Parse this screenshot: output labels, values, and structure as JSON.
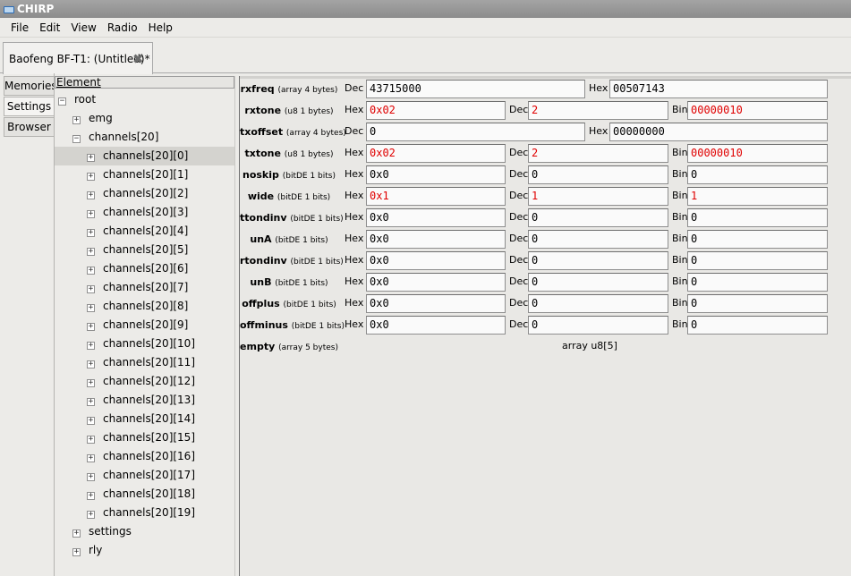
{
  "window": {
    "title": "CHIRP"
  },
  "menu": [
    "File",
    "Edit",
    "View",
    "Radio",
    "Help"
  ],
  "doc_tab": {
    "label": "Baofeng BF-T1: (Untitled)*"
  },
  "side_tabs": [
    "Memories",
    "Settings",
    "Browser"
  ],
  "tree": {
    "header": "Element",
    "nodes": [
      {
        "label": "root",
        "level": 0,
        "exp": "−"
      },
      {
        "label": "emg",
        "level": 1,
        "exp": "+"
      },
      {
        "label": "channels[20]",
        "level": 1,
        "exp": "−"
      },
      {
        "label": "channels[20][0]",
        "level": 2,
        "exp": "+",
        "selected": true
      },
      {
        "label": "channels[20][1]",
        "level": 2,
        "exp": "+"
      },
      {
        "label": "channels[20][2]",
        "level": 2,
        "exp": "+"
      },
      {
        "label": "channels[20][3]",
        "level": 2,
        "exp": "+"
      },
      {
        "label": "channels[20][4]",
        "level": 2,
        "exp": "+"
      },
      {
        "label": "channels[20][5]",
        "level": 2,
        "exp": "+"
      },
      {
        "label": "channels[20][6]",
        "level": 2,
        "exp": "+"
      },
      {
        "label": "channels[20][7]",
        "level": 2,
        "exp": "+"
      },
      {
        "label": "channels[20][8]",
        "level": 2,
        "exp": "+"
      },
      {
        "label": "channels[20][9]",
        "level": 2,
        "exp": "+"
      },
      {
        "label": "channels[20][10]",
        "level": 2,
        "exp": "+"
      },
      {
        "label": "channels[20][11]",
        "level": 2,
        "exp": "+"
      },
      {
        "label": "channels[20][12]",
        "level": 2,
        "exp": "+"
      },
      {
        "label": "channels[20][13]",
        "level": 2,
        "exp": "+"
      },
      {
        "label": "channels[20][14]",
        "level": 2,
        "exp": "+"
      },
      {
        "label": "channels[20][15]",
        "level": 2,
        "exp": "+"
      },
      {
        "label": "channels[20][16]",
        "level": 2,
        "exp": "+"
      },
      {
        "label": "channels[20][17]",
        "level": 2,
        "exp": "+"
      },
      {
        "label": "channels[20][18]",
        "level": 2,
        "exp": "+"
      },
      {
        "label": "channels[20][19]",
        "level": 2,
        "exp": "+"
      },
      {
        "label": "settings",
        "level": 1,
        "exp": "+"
      },
      {
        "label": "rly",
        "level": 1,
        "exp": "+"
      }
    ]
  },
  "fields": {
    "rxfreq": {
      "name": "rxfreq",
      "type": "(array 4 bytes)",
      "l1": "Dec",
      "v1": "43715000",
      "l2": "Hex",
      "v2": "00507143"
    },
    "rxtone": {
      "name": "rxtone",
      "type": "(u8 1 bytes)",
      "l1": "Hex",
      "v1": "0x02",
      "l2": "Dec",
      "v2": "2",
      "l3": "Bin",
      "v3": "00000010"
    },
    "txoffset": {
      "name": "txoffset",
      "type": "(array 4 bytes)",
      "l1": "Dec",
      "v1": "0",
      "l2": "Hex",
      "v2": "00000000"
    },
    "txtone": {
      "name": "txtone",
      "type": "(u8 1 bytes)",
      "l1": "Hex",
      "v1": "0x02",
      "l2": "Dec",
      "v2": "2",
      "l3": "Bin",
      "v3": "00000010"
    },
    "noskip": {
      "name": "noskip",
      "type": "(bitDE 1 bits)",
      "l1": "Hex",
      "v1": "0x0",
      "l2": "Dec",
      "v2": "0",
      "l3": "Bin",
      "v3": "0"
    },
    "wide": {
      "name": "wide",
      "type": "(bitDE 1 bits)",
      "l1": "Hex",
      "v1": "0x1",
      "l2": "Dec",
      "v2": "1",
      "l3": "Bin",
      "v3": "1"
    },
    "ttondinv": {
      "name": "ttondinv",
      "type": "(bitDE 1 bits)",
      "l1": "Hex",
      "v1": "0x0",
      "l2": "Dec",
      "v2": "0",
      "l3": "Bin",
      "v3": "0"
    },
    "unA": {
      "name": "unA",
      "type": "(bitDE 1 bits)",
      "l1": "Hex",
      "v1": "0x0",
      "l2": "Dec",
      "v2": "0",
      "l3": "Bin",
      "v3": "0"
    },
    "rtondinv": {
      "name": "rtondinv",
      "type": "(bitDE 1 bits)",
      "l1": "Hex",
      "v1": "0x0",
      "l2": "Dec",
      "v2": "0",
      "l3": "Bin",
      "v3": "0"
    },
    "unB": {
      "name": "unB",
      "type": "(bitDE 1 bits)",
      "l1": "Hex",
      "v1": "0x0",
      "l2": "Dec",
      "v2": "0",
      "l3": "Bin",
      "v3": "0"
    },
    "offplus": {
      "name": "offplus",
      "type": "(bitDE 1 bits)",
      "l1": "Hex",
      "v1": "0x0",
      "l2": "Dec",
      "v2": "0",
      "l3": "Bin",
      "v3": "0"
    },
    "offminus": {
      "name": "offminus",
      "type": "(bitDE 1 bits)",
      "l1": "Hex",
      "v1": "0x0",
      "l2": "Dec",
      "v2": "0",
      "l3": "Bin",
      "v3": "0"
    },
    "empty": {
      "name": "empty",
      "type": "(array 5 bytes)",
      "desc": "array u8[5]"
    }
  },
  "colors": {
    "modified_value": "#e00000"
  }
}
